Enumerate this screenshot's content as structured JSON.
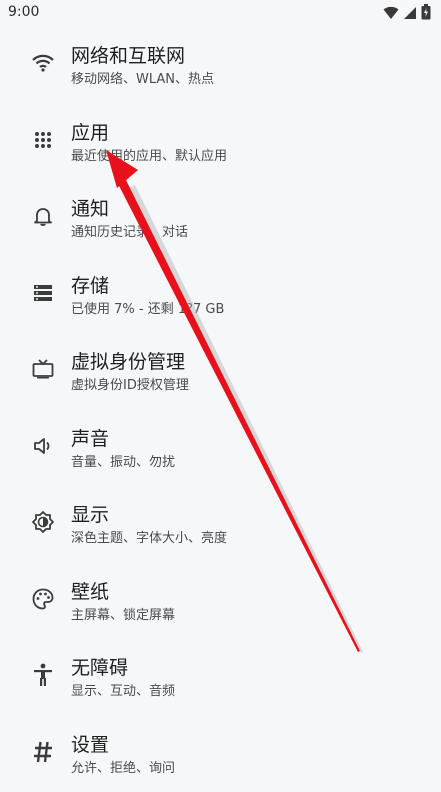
{
  "status_bar": {
    "time": "9:00",
    "icons": [
      "wifi-icon",
      "signal-icon",
      "battery-icon"
    ]
  },
  "settings": [
    {
      "icon": "wifi-icon",
      "title": "网络和互联网",
      "subtitle": "移动网络、WLAN、热点"
    },
    {
      "icon": "apps-grid-icon",
      "title": "应用",
      "subtitle": "最近使用的应用、默认应用"
    },
    {
      "icon": "bell-icon",
      "title": "通知",
      "subtitle": "通知历史记录、对话"
    },
    {
      "icon": "storage-icon",
      "title": "存储",
      "subtitle": "已使用 7% - 还剩 1?7 GB"
    },
    {
      "icon": "tv-icon",
      "title": "虚拟身份管理",
      "subtitle": "虚拟身份ID授权管理"
    },
    {
      "icon": "volume-icon",
      "title": "声音",
      "subtitle": "音量、振动、勿扰"
    },
    {
      "icon": "brightness-icon",
      "title": "显示",
      "subtitle": "深色主题、字体大小、亮度"
    },
    {
      "icon": "palette-icon",
      "title": "壁纸",
      "subtitle": "主屏幕、锁定屏幕"
    },
    {
      "icon": "accessibility-icon",
      "title": "无障碍",
      "subtitle": "显示、互动、音频"
    },
    {
      "icon": "hash-icon",
      "title": "设置",
      "subtitle": "允许、拒绝、询问"
    }
  ],
  "colors": {
    "background": "#f6f7f9",
    "arrow": "#e8101a",
    "icon": "#3c3c3c"
  }
}
